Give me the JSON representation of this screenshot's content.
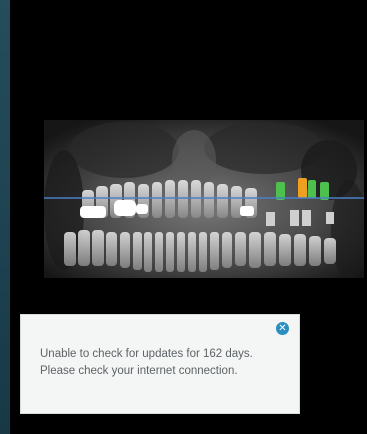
{
  "notification": {
    "message": "Unable to check for updates for 162 days. Please check your internet connection.",
    "close_icon": "close-icon",
    "close_glyph": "✕"
  },
  "viewer": {
    "image": "panoramic-dental-xray",
    "reference_line_color": "#4a80c8",
    "implant_marker_colors": [
      "#4ec04e",
      "#f0a020",
      "#4ec04e",
      "#4ec04e"
    ]
  }
}
